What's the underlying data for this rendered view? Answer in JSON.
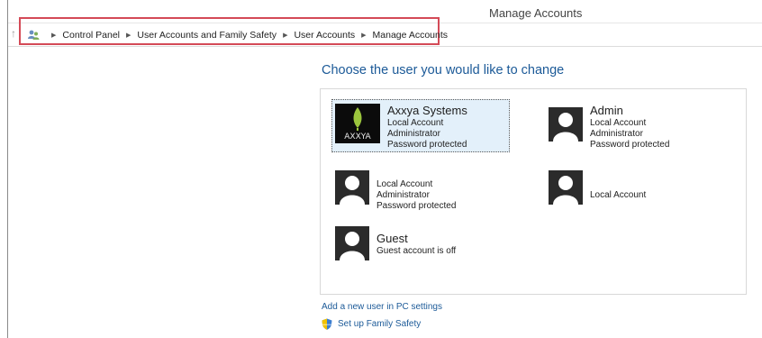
{
  "window": {
    "title": "Manage Accounts"
  },
  "breadcrumb": {
    "items": [
      "Control Panel",
      "User Accounts and Family Safety",
      "User Accounts",
      "Manage Accounts"
    ]
  },
  "main": {
    "heading": "Choose the user you would like to change",
    "accounts": [
      {
        "name": "Axxya Systems",
        "lines": [
          "Local Account",
          "Administrator",
          "Password protected"
        ]
      },
      {
        "name": "Admin",
        "lines": [
          "Local Account",
          "Administrator",
          "Password protected"
        ]
      },
      {
        "name": "",
        "lines": [
          "Local Account",
          "Administrator",
          "Password protected"
        ]
      },
      {
        "name": "",
        "lines": [
          "Local Account"
        ]
      },
      {
        "name": "Guest",
        "lines": [
          "Guest account is off"
        ]
      }
    ],
    "links": {
      "add_user": "Add a new user in PC settings",
      "family_safety": "Set up Family Safety"
    }
  },
  "logo": {
    "text": "AXXYA"
  },
  "colors": {
    "accent": "#1c5a98",
    "highlight_border": "#d44a57",
    "selected_bg": "#e3f0fa"
  }
}
